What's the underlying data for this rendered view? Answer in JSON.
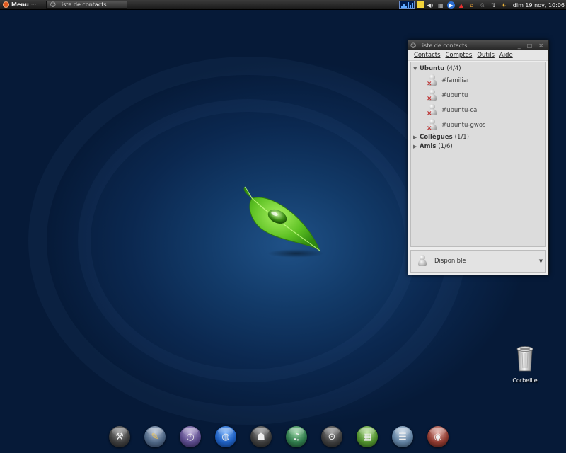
{
  "top_panel": {
    "menu_label": "Menu",
    "task_title": "Liste de contacts",
    "clock": "dim 19 nov, 10:06",
    "tray_icons": [
      "cpu-monitor",
      "notes",
      "volume",
      "network",
      "media-player",
      "alert",
      "home-folder",
      "rabbit",
      "network-manager",
      "weather"
    ]
  },
  "window": {
    "title": "Liste de contacts",
    "menus": [
      "Contacts",
      "Comptes",
      "Outils",
      "Aide"
    ],
    "groups": [
      {
        "name": "Ubuntu",
        "count": "(4/4)",
        "expanded": true,
        "contacts": [
          "#familiar",
          "#ubuntu",
          "#ubuntu-ca",
          "#ubuntu-gwos"
        ]
      },
      {
        "name": "Collègues",
        "count": "(1/1)",
        "expanded": false,
        "contacts": []
      },
      {
        "name": "Amis",
        "count": "(1/6)",
        "expanded": false,
        "contacts": []
      }
    ],
    "status": "Disponible"
  },
  "desktop": {
    "trash_label": "Corbeille"
  },
  "dock": {
    "items": [
      "tools-icon",
      "pencil-icon",
      "clock-icon",
      "globe-icon",
      "hat-icon",
      "sound-icon",
      "mouse-icon",
      "spreadsheet-icon",
      "document-icon",
      "media-icon"
    ]
  },
  "colors": {
    "desktop_bg": "#0b2850",
    "leaf_green": "#6fd12e",
    "window_bg": "#ededed",
    "panel_bg": "#2b2b2b"
  }
}
